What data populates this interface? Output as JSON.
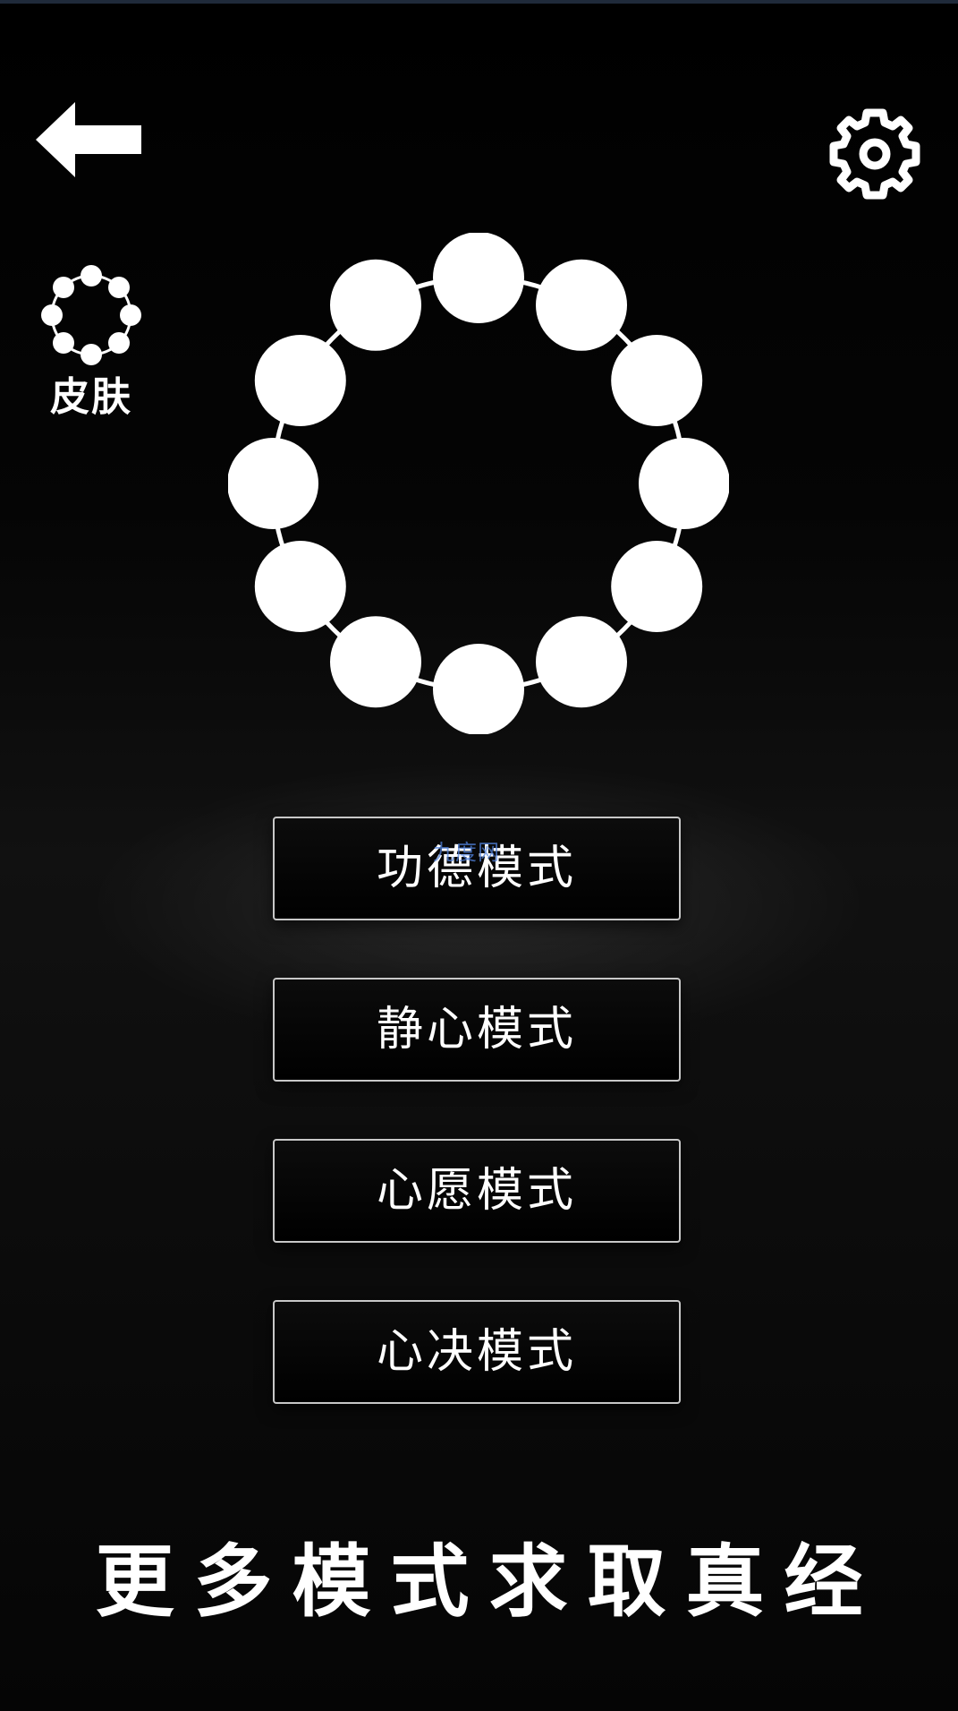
{
  "screen": {
    "back_icon": "arrow-left-icon",
    "settings_icon": "gear-icon",
    "skin": {
      "icon": "bead-ring-icon",
      "label": "皮肤"
    },
    "bracelet": {
      "bead_count": 12,
      "bead_color": "#ffffff"
    },
    "modes": [
      {
        "label": "功德模式"
      },
      {
        "label": "静心模式"
      },
      {
        "label": "心愿模式"
      },
      {
        "label": "心决模式"
      }
    ],
    "watermark": "九度网",
    "slogan": "更多模式求取真经"
  }
}
